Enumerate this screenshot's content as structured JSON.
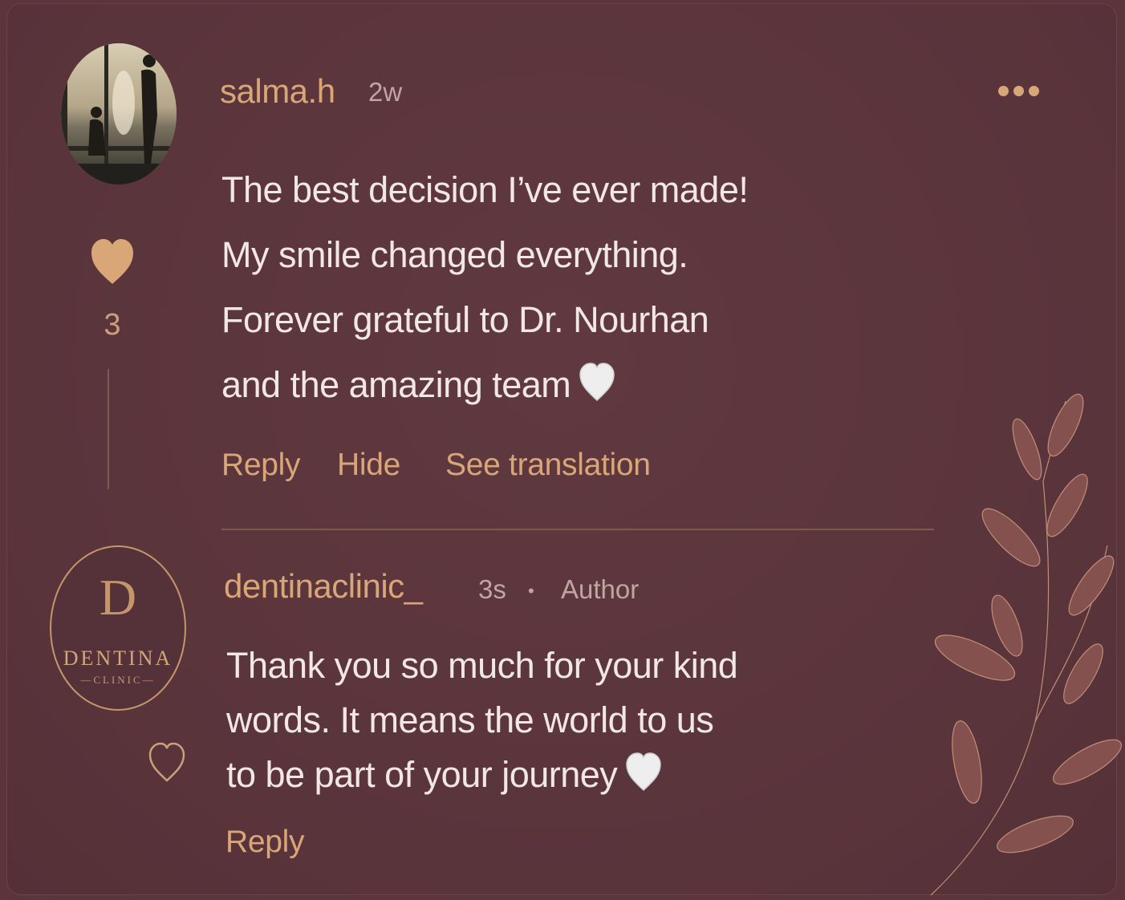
{
  "colors": {
    "background": "#5c353c",
    "accent_gold": "#d9a678",
    "text_light": "#f1e7e5",
    "meta_muted": "#c0a5a0"
  },
  "comment": {
    "username": "salma.h",
    "time": "2w",
    "lines": [
      "The best decision I’ve ever made!",
      "My smile changed everything.",
      "Forever grateful to Dr. Nourhan",
      "and the amazing team"
    ],
    "like_icon": "heart-filled-icon",
    "like_count": "3",
    "actions": {
      "reply": "Reply",
      "hide": "Hide",
      "see_translation": "See translation"
    },
    "more_icon": "more-horizontal-icon"
  },
  "reply": {
    "username": "dentinaclinic_",
    "time": "3s",
    "separator": "•",
    "badge": "Author",
    "logo": {
      "monogram": "D",
      "name": "DENTINA",
      "sub": "—CLINIC—"
    },
    "lines": [
      "Thank you so much for your kind",
      "words. It means the world to us",
      "to be part of your journey"
    ],
    "like_icon": "heart-outline-icon",
    "actions": {
      "reply": "Reply"
    }
  }
}
